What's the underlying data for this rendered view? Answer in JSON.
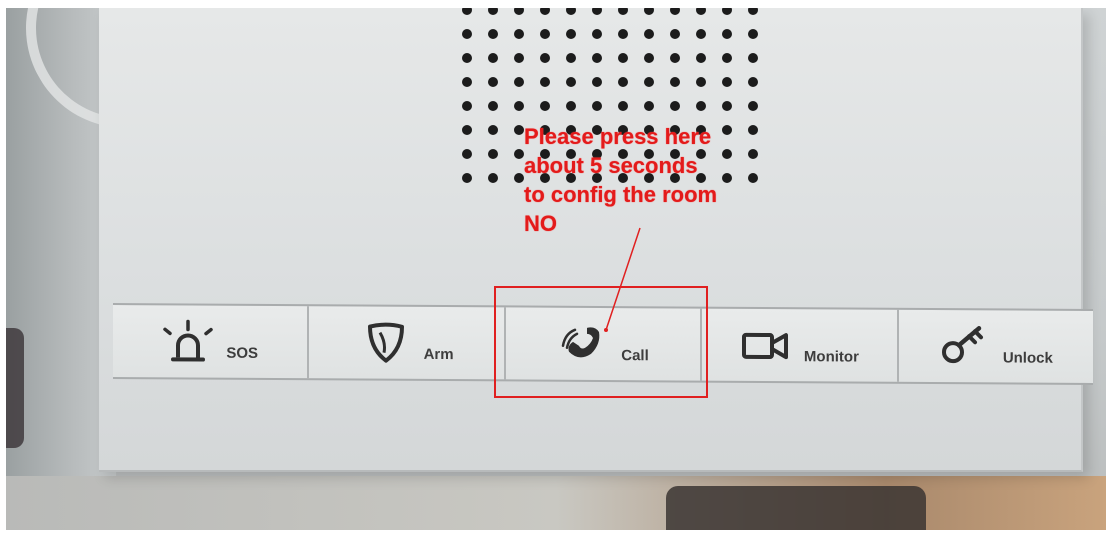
{
  "annotation": {
    "lines": [
      "Please press here",
      "about 5 seconds",
      "to config the room",
      "NO"
    ]
  },
  "buttons": [
    {
      "label": "SOS",
      "icon": "alarm-light-icon"
    },
    {
      "label": "Arm",
      "icon": "shield-icon"
    },
    {
      "label": "Call",
      "icon": "phone-ringing-icon"
    },
    {
      "label": "Monitor",
      "icon": "video-camera-icon"
    },
    {
      "label": "Unlock",
      "icon": "key-icon"
    }
  ],
  "colors": {
    "annotation": "#e31b1b",
    "panel": "#e3e5e6",
    "icon": "#2f2f2f"
  }
}
